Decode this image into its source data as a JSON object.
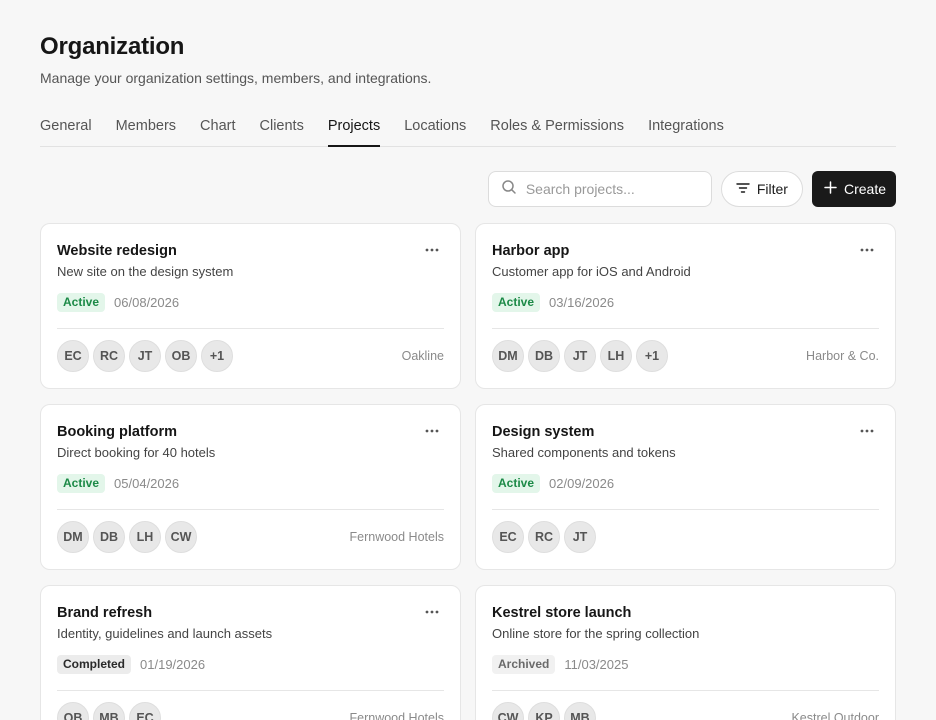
{
  "header": {
    "title": "Organization",
    "subtitle": "Manage your organization settings, members, and integrations."
  },
  "tabs": [
    {
      "label": "General"
    },
    {
      "label": "Members"
    },
    {
      "label": "Chart"
    },
    {
      "label": "Clients"
    },
    {
      "label": "Projects",
      "active": true
    },
    {
      "label": "Locations"
    },
    {
      "label": "Roles & Permissions"
    },
    {
      "label": "Integrations"
    }
  ],
  "toolbar": {
    "search_placeholder": "Search projects...",
    "search_icon": "search-icon",
    "filter_label": "Filter",
    "filter_icon": "filter-icon",
    "create_label": "Create",
    "create_icon": "plus-icon"
  },
  "projects": [
    {
      "name": "Website redesign",
      "description": "New site on the design system",
      "status": "Active",
      "status_type": "active",
      "date": "06/08/2026",
      "members": [
        "EC",
        "RC",
        "JT",
        "OB",
        "+1"
      ],
      "client": "Oakline"
    },
    {
      "name": "Harbor app",
      "description": "Customer app for iOS and Android",
      "status": "Active",
      "status_type": "active",
      "date": "03/16/2026",
      "members": [
        "DM",
        "DB",
        "JT",
        "LH",
        "+1"
      ],
      "client": "Harbor & Co."
    },
    {
      "name": "Booking platform",
      "description": "Direct booking for 40 hotels",
      "status": "Active",
      "status_type": "active",
      "date": "05/04/2026",
      "members": [
        "DM",
        "DB",
        "LH",
        "CW"
      ],
      "client": "Fernwood Hotels"
    },
    {
      "name": "Design system",
      "description": "Shared components and tokens",
      "status": "Active",
      "status_type": "active",
      "date": "02/09/2026",
      "members": [
        "EC",
        "RC",
        "JT"
      ],
      "client": ""
    },
    {
      "name": "Brand refresh",
      "description": "Identity, guidelines and launch assets",
      "status": "Completed",
      "status_type": "completed",
      "date": "01/19/2026",
      "members": [
        "OB",
        "MB",
        "EC"
      ],
      "client": "Fernwood Hotels"
    },
    {
      "name": "Kestrel store launch",
      "description": "Online store for the spring collection",
      "status": "Archived",
      "status_type": "archived",
      "date": "11/03/2025",
      "members": [
        "CW",
        "KP",
        "MB"
      ],
      "client": "Kestrel Outdoor"
    }
  ],
  "colors": {
    "accent_dark": "#1a1a1a",
    "active_badge_bg": "#e3f6ea",
    "active_badge_text": "#1c8a47"
  }
}
